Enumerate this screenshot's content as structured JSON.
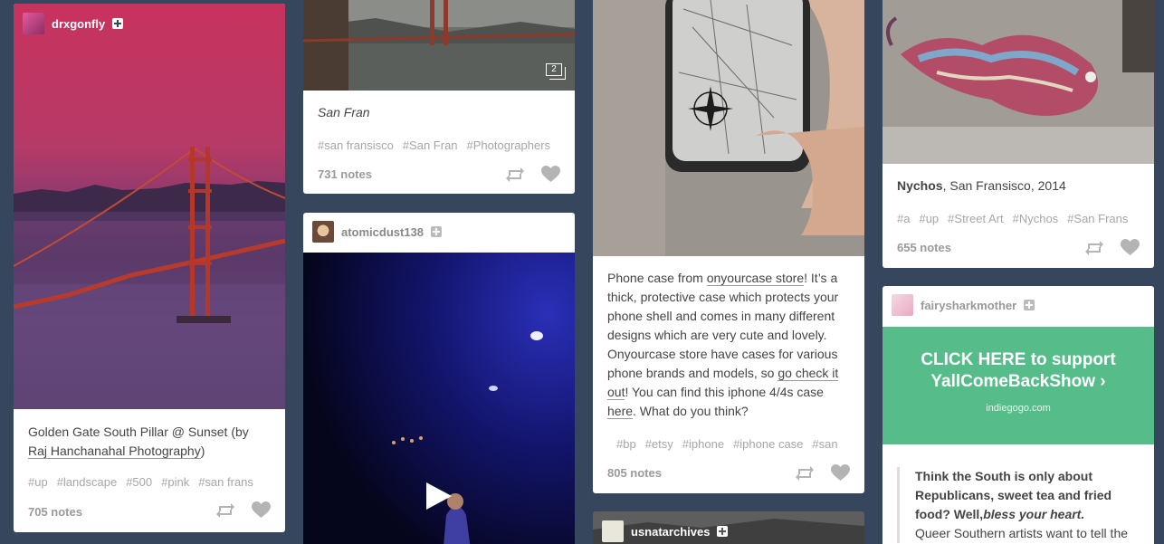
{
  "colors": {
    "dashboard_bg": "#36465d",
    "card_bg": "#ffffff",
    "text": "#444444",
    "tag": "#a6a6a6",
    "notes": "#9a9a9a",
    "donate_green": "#56bc8a"
  },
  "posts": {
    "p1": {
      "blog": "drxgonfly",
      "caption_pre": "Golden Gate South Pillar @ Sunset (by ",
      "caption_link": "Raj Hanchanahal Photography",
      "caption_post": ")",
      "tags": [
        "#up",
        "#landscape",
        "#500",
        "#pink",
        "#san frans"
      ],
      "notes": "705 notes"
    },
    "p2": {
      "photo_count": "2",
      "caption": "San Fran",
      "tags": [
        "#san fransisco",
        "#San Fran",
        "#Photographers"
      ],
      "notes": "731 notes"
    },
    "p3": {
      "blog": "atomicdust138"
    },
    "p4": {
      "body_1": "Phone case from ",
      "link_1": "onyourcase store",
      "body_2": "! It’s a thick, protective case which protects your phone shell and comes in many different designs which are very cute and lovely. Onyourcase store have cases for various phone brands and models, so ",
      "link_2": "go check it out",
      "body_3": "! You can find this iphone 4/4s case ",
      "link_3": "here",
      "body_4": ". What do you think?",
      "tags": [
        "#bp",
        "#etsy",
        "#iphone",
        "#iphone case",
        "#san"
      ],
      "notes": "805 notes"
    },
    "p5": {
      "blog": "usnatarchives"
    },
    "p6": {
      "caption_bold": "Nychos",
      "caption_rest": ", San Fransisco, 2014",
      "tags": [
        "#a",
        "#up",
        "#Street Art",
        "#Nychos",
        "#San Frans"
      ],
      "notes": "655 notes"
    },
    "p7": {
      "blog": "fairysharkmother",
      "cta_line1": "CLICK HERE to support",
      "cta_line2": "YallComeBackShow ›",
      "cta_domain": "indiegogo.com",
      "quote_bold": "Think the South is only about Republicans, sweet tea and fried food? Well,",
      "quote_italic": "bless your heart.",
      "quote_rest": "Queer Southern artists want to tell the"
    }
  },
  "icons": {
    "reblog": "reblog-icon",
    "like": "heart-icon",
    "follow": "plus-icon",
    "play": "play-icon",
    "photoset": "photoset-icon"
  }
}
